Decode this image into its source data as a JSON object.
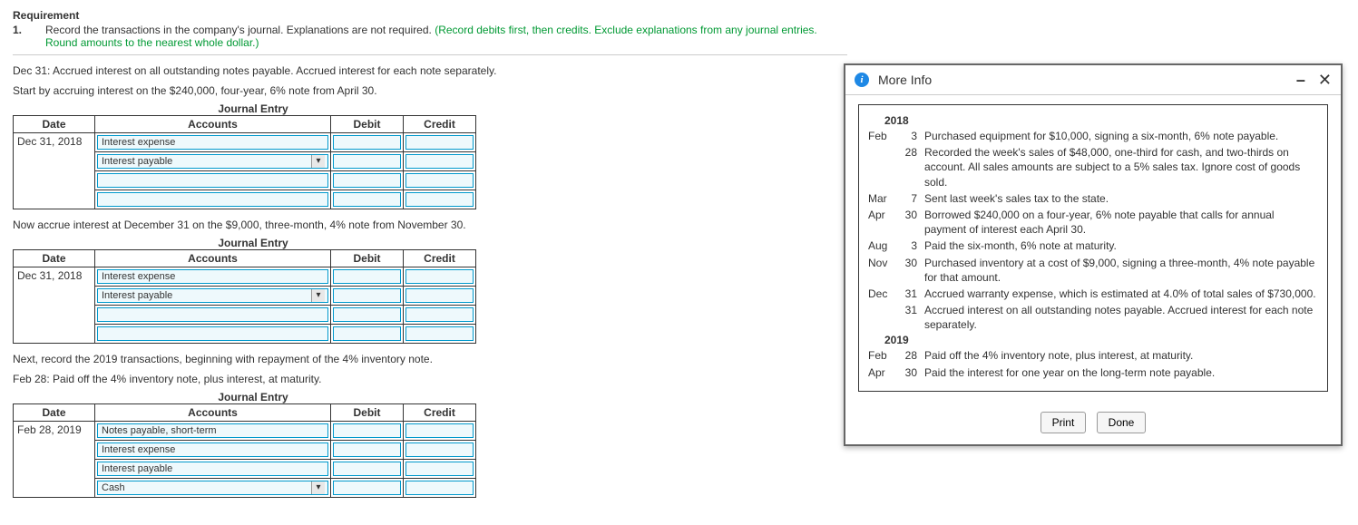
{
  "requirement": {
    "title": "Requirement",
    "number": "1.",
    "text_black": "Record the transactions in the company's journal. Explanations are not required. ",
    "text_green": "(Record debits first, then credits. Exclude explanations from any journal entries. Round amounts to the nearest whole dollar.)"
  },
  "intro1": "Dec 31: Accrued interest on all outstanding notes payable. Accrued interest for each note separately.",
  "intro2": "Start by accruing interest on the $240,000, four-year, 6% note from April 30.",
  "je_caption": "Journal Entry",
  "headers": {
    "date": "Date",
    "accounts": "Accounts",
    "debit": "Debit",
    "credit": "Credit"
  },
  "je1": {
    "date": "Dec 31, 2018",
    "rows": [
      {
        "account": "Interest expense",
        "dropdown": false
      },
      {
        "account": "Interest payable",
        "dropdown": true
      },
      {
        "account": "",
        "dropdown": false
      },
      {
        "account": "",
        "dropdown": false
      }
    ]
  },
  "intro3": "Now accrue interest at December 31 on the $9,000, three-month, 4% note from November 30.",
  "je2": {
    "date": "Dec 31, 2018",
    "rows": [
      {
        "account": "Interest expense",
        "dropdown": false
      },
      {
        "account": "Interest payable",
        "dropdown": true
      },
      {
        "account": "",
        "dropdown": false
      },
      {
        "account": "",
        "dropdown": false
      }
    ]
  },
  "intro4a": "Next, record the 2019 transactions, beginning with repayment of the 4% inventory note.",
  "intro4b": "Feb 28: Paid off the 4% inventory note, plus interest, at maturity.",
  "je3": {
    "date": "Feb 28, 2019",
    "rows": [
      {
        "account": "Notes payable, short-term",
        "dropdown": false
      },
      {
        "account": "Interest expense",
        "dropdown": false
      },
      {
        "account": "Interest payable",
        "dropdown": false
      },
      {
        "account": "Cash",
        "dropdown": true
      }
    ]
  },
  "dialog": {
    "title": "More Info",
    "year1": "2018",
    "year2": "2019",
    "entries2018": [
      {
        "mon": "Feb",
        "day": "3",
        "desc": "Purchased equipment for $10,000, signing a six-month, 6% note payable."
      },
      {
        "mon": "",
        "day": "28",
        "desc": "Recorded the week's sales of $48,000, one-third for cash, and two-thirds on account. All sales amounts are subject to a 5% sales tax. Ignore cost of goods sold."
      },
      {
        "mon": "Mar",
        "day": "7",
        "desc": "Sent last week's sales tax to the state."
      },
      {
        "mon": "Apr",
        "day": "30",
        "desc": "Borrowed $240,000 on a four-year, 6% note payable that calls for annual payment of interest each April 30."
      },
      {
        "mon": "Aug",
        "day": "3",
        "desc": "Paid the six-month, 6% note at maturity."
      },
      {
        "mon": "Nov",
        "day": "30",
        "desc": "Purchased inventory at a cost of $9,000, signing a three-month, 4% note payable for that amount."
      },
      {
        "mon": "Dec",
        "day": "31",
        "desc": "Accrued warranty expense, which is estimated at 4.0% of total sales of $730,000."
      },
      {
        "mon": "",
        "day": "31",
        "desc": "Accrued interest on all outstanding notes payable. Accrued interest for each note separately."
      }
    ],
    "entries2019": [
      {
        "mon": "Feb",
        "day": "28",
        "desc": "Paid off the 4% inventory note, plus interest, at maturity."
      },
      {
        "mon": "Apr",
        "day": "30",
        "desc": "Paid the interest for one year on the long-term note payable."
      }
    ],
    "print": "Print",
    "done": "Done"
  }
}
